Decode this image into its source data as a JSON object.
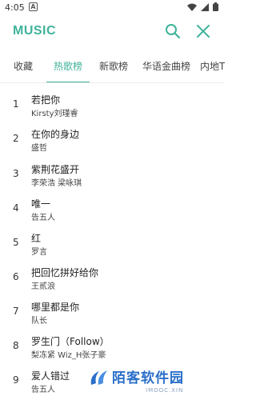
{
  "status_bar": {
    "time": "4:05",
    "alert": "A"
  },
  "app_bar": {
    "title": "MUSIC"
  },
  "tabs": [
    {
      "label": "收藏",
      "active": false
    },
    {
      "label": "热歌榜",
      "active": true
    },
    {
      "label": "新歌榜",
      "active": false
    },
    {
      "label": "华语金曲榜",
      "active": false
    },
    {
      "label": "内地TO",
      "active": false
    }
  ],
  "songs": [
    {
      "rank": "1",
      "title": "若把你",
      "artist": "Kirsty刘瑾睿"
    },
    {
      "rank": "2",
      "title": "在你的身边",
      "artist": "盛哲"
    },
    {
      "rank": "3",
      "title": "紫荆花盛开",
      "artist": "李荣浩  梁咏琪"
    },
    {
      "rank": "4",
      "title": "唯一",
      "artist": "告五人"
    },
    {
      "rank": "5",
      "title": "红",
      "artist": "罗言"
    },
    {
      "rank": "6",
      "title": "把回忆拼好给你",
      "artist": "王贰浪"
    },
    {
      "rank": "7",
      "title": "哪里都是你",
      "artist": "队长"
    },
    {
      "rank": "8",
      "title": "罗生门（Follow）",
      "artist": "梨冻紧  Wiz_H张子豪"
    },
    {
      "rank": "9",
      "title": "爱人错过",
      "artist": "告五人"
    }
  ],
  "watermark": {
    "text": "陌客软件园",
    "sub": "IMOOC.XIN"
  },
  "colors": {
    "accent": "#3fb29a",
    "watermark": "#2a6fc9"
  },
  "icons": [
    "search-icon",
    "close-icon",
    "wifi-icon",
    "signal-icon",
    "battery-icon"
  ]
}
